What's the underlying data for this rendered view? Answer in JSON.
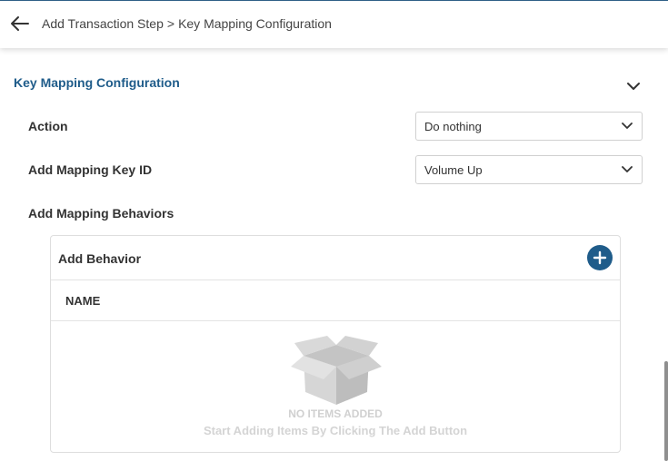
{
  "header": {
    "back_icon": "arrow-left-icon",
    "breadcrumb": {
      "parent": "Add Transaction Step",
      "separator": ">",
      "current": "Key Mapping Configuration"
    }
  },
  "section": {
    "title": "Key Mapping Configuration",
    "collapse_icon": "chevron-down-icon"
  },
  "fields": {
    "action": {
      "label": "Action",
      "value": "Do nothing"
    },
    "mapping_key_id": {
      "label": "Add Mapping Key ID",
      "value": "Volume Up"
    },
    "behaviors_label": "Add Mapping Behaviors"
  },
  "behaviors_card": {
    "title": "Add Behavior",
    "add_icon": "plus-circle-icon",
    "columns": [
      "NAME"
    ],
    "rows": [],
    "empty_icon": "open-box-icon",
    "empty_title": "NO ITEMS ADDED",
    "empty_subtitle": "Start Adding Items By Clicking The Add Button"
  },
  "colors": {
    "accent": "#1f5c8a",
    "text": "#333333",
    "border": "#d0d0d0"
  }
}
